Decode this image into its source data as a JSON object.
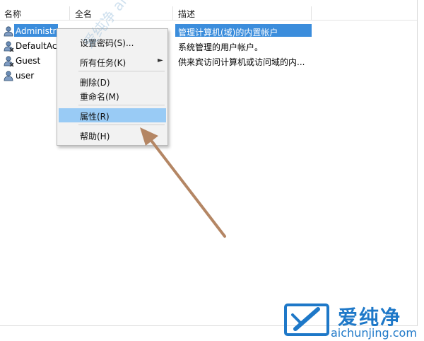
{
  "columns": [
    "名称",
    "全名",
    "描述"
  ],
  "rows": [
    {
      "name": "Administrat",
      "fullname": "",
      "desc": "管理计算机(域)的内置帐户",
      "selected": true
    },
    {
      "name": "DefaultAcc",
      "fullname": "",
      "desc": "系统管理的用户帐户。",
      "selected": false
    },
    {
      "name": "Guest",
      "fullname": "",
      "desc": "供来宾访问计算机或访问域的内...",
      "selected": false
    },
    {
      "name": "user",
      "fullname": "",
      "desc": "",
      "selected": false
    }
  ],
  "context_menu": {
    "set_password": "设置密码(S)...",
    "all_tasks": "所有任务(K)",
    "delete": "删除(D)",
    "rename": "重命名(M)",
    "properties": "属性(R)",
    "help": "帮助(H)"
  },
  "watermark": {
    "overlay_text": "爱纯净 aichunjing.com",
    "brand": "爱纯净",
    "url": "aichunjing.com"
  },
  "colors": {
    "selection": "#3b8ddc",
    "menu_hover": "#99cbf5",
    "arrow": "#b48664",
    "brand": "#1e78c8"
  }
}
